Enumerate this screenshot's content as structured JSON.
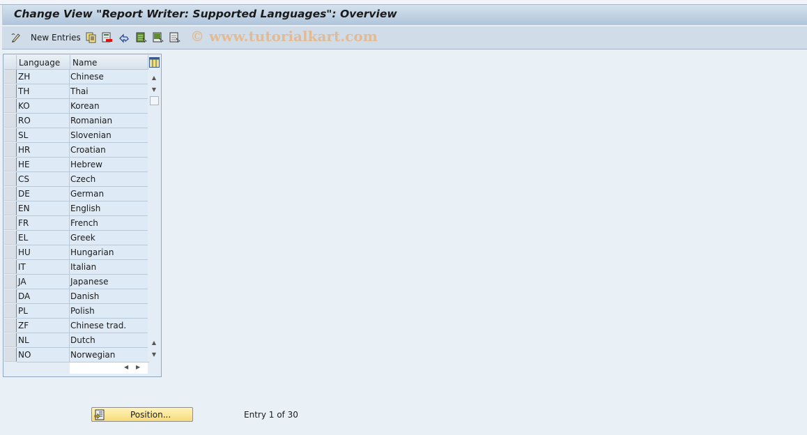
{
  "window": {
    "title": "Change View \"Report Writer: Supported Languages\": Overview"
  },
  "toolbar": {
    "new_entries_label": "New Entries",
    "icons": [
      {
        "name": "display-change-icon"
      },
      {
        "name": "copy-as-icon"
      },
      {
        "name": "delete-icon"
      },
      {
        "name": "undo-change-icon"
      },
      {
        "name": "select-all-icon"
      },
      {
        "name": "select-block-icon"
      },
      {
        "name": "deselect-all-icon"
      }
    ],
    "watermark": "© www.tutorialkart.com"
  },
  "table": {
    "columns": [
      "Language",
      "Name"
    ],
    "rows": [
      {
        "language": "ZH",
        "name": "Chinese"
      },
      {
        "language": "TH",
        "name": "Thai"
      },
      {
        "language": "KO",
        "name": "Korean"
      },
      {
        "language": "RO",
        "name": "Romanian"
      },
      {
        "language": "SL",
        "name": "Slovenian"
      },
      {
        "language": "HR",
        "name": "Croatian"
      },
      {
        "language": "HE",
        "name": "Hebrew"
      },
      {
        "language": "CS",
        "name": "Czech"
      },
      {
        "language": "DE",
        "name": "German"
      },
      {
        "language": "EN",
        "name": "English"
      },
      {
        "language": "FR",
        "name": "French"
      },
      {
        "language": "EL",
        "name": "Greek"
      },
      {
        "language": "HU",
        "name": "Hungarian"
      },
      {
        "language": "IT",
        "name": "Italian"
      },
      {
        "language": "JA",
        "name": "Japanese"
      },
      {
        "language": "DA",
        "name": "Danish"
      },
      {
        "language": "PL",
        "name": "Polish"
      },
      {
        "language": "ZF",
        "name": "Chinese trad."
      },
      {
        "language": "NL",
        "name": "Dutch"
      },
      {
        "language": "NO",
        "name": "Norwegian"
      }
    ]
  },
  "footer": {
    "position_label": "Position...",
    "entry_info": "Entry 1 of 30"
  }
}
